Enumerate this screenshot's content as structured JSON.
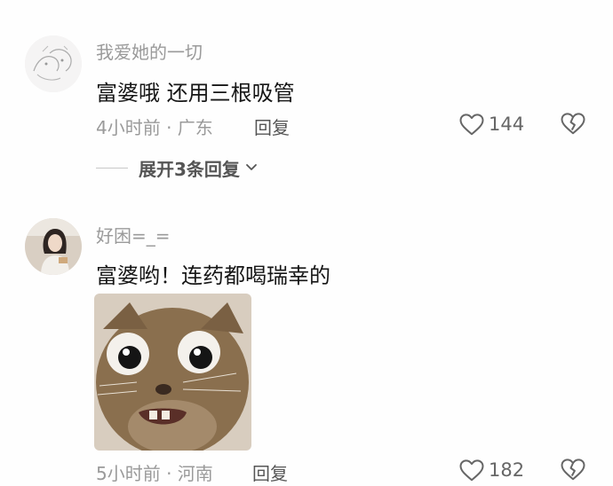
{
  "comments": [
    {
      "username": "我爱她的一切",
      "text": "富婆哦 还用三根吸管",
      "meta": "4小时前 · 广东",
      "reply_label": "回复",
      "likes": "144",
      "expand_label": "展开3条回复"
    },
    {
      "username": "好困=_=",
      "text": "富婆哟！连药都喝瑞幸的",
      "meta": "5小时前 · 河南",
      "reply_label": "回复",
      "likes": "182"
    }
  ],
  "icons": {
    "like": "heart-outline-icon",
    "dislike": "broken-heart-icon",
    "expand": "chevron-down-icon"
  },
  "colors": {
    "username": "#9a9a9a",
    "text": "#161616",
    "meta": "#9a9a9a",
    "icon": "#666666"
  }
}
